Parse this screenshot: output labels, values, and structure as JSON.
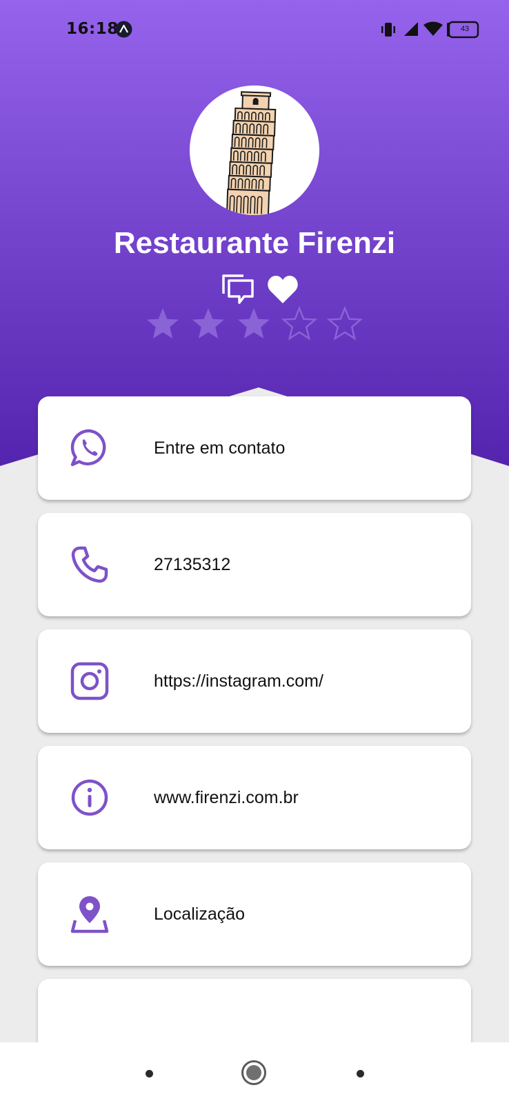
{
  "status_bar": {
    "time": "16:18",
    "battery": "43",
    "icons": [
      "app-notification-icon",
      "vibrate-icon",
      "cell-signal-icon",
      "wifi-icon",
      "battery-icon"
    ]
  },
  "profile": {
    "name": "Restaurante Firenzi",
    "avatar_icon": "leaning-tower-of-pisa-image",
    "actions": [
      "comments-icon",
      "favorite-heart-icon"
    ],
    "rating": {
      "value": 3,
      "max": 5
    }
  },
  "contacts": [
    {
      "icon": "whatsapp-icon",
      "label": "Entre em contato"
    },
    {
      "icon": "phone-icon",
      "label": "27135312"
    },
    {
      "icon": "instagram-icon",
      "label": "https://instagram.com/"
    },
    {
      "icon": "info-icon",
      "label": "www.firenzi.com.br"
    },
    {
      "icon": "location-pin-icon",
      "label": "Localização"
    },
    {
      "icon": "",
      "label": ""
    }
  ],
  "colors": {
    "gradient_top": "#9563ec",
    "gradient_bottom": "#5424ae",
    "accent": "#7e52c8",
    "background": "#ececec"
  }
}
